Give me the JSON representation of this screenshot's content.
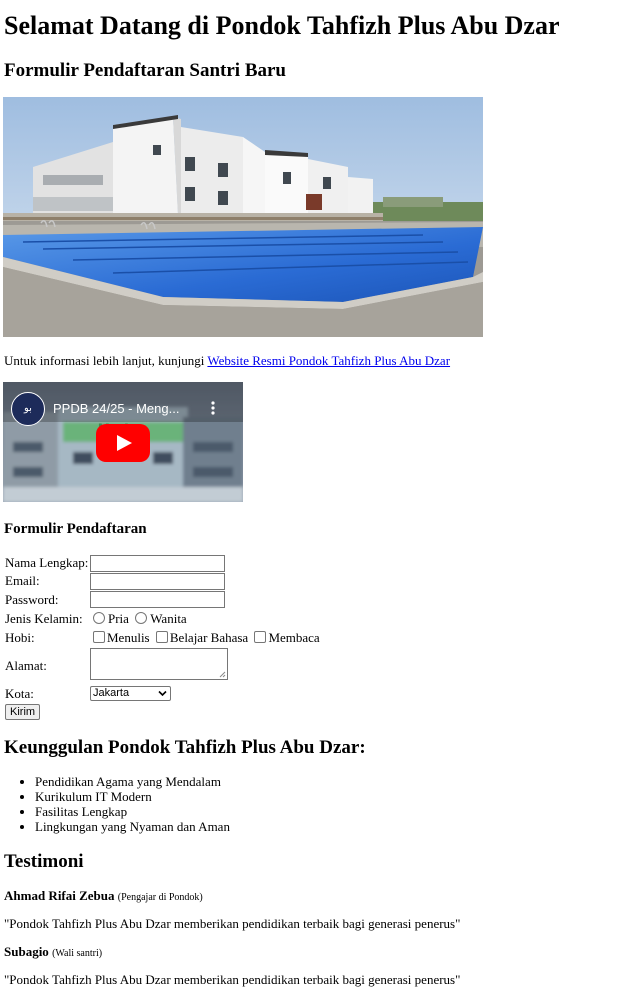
{
  "header": {
    "title": "Selamat Datang di Pondok Tahfizh Plus Abu Dzar",
    "subtitle": "Formulir Pendaftaran Santri Baru"
  },
  "info": {
    "text": "Untuk informasi lebih lanjut, kunjungi ",
    "link_text": "Website Resmi Pondok Tahfizh Plus Abu Dzar"
  },
  "video": {
    "title": "PPDB 24/25 - Meng...",
    "channel_badge": "بو",
    "banner": "M...A"
  },
  "form": {
    "title": "Formulir Pendaftaran",
    "labels": {
      "nama": "Nama Lengkap:",
      "email": "Email:",
      "password": "Password:",
      "jenis_kelamin": "Jenis Kelamin:",
      "hobi": "Hobi:",
      "alamat": "Alamat:",
      "kota": "Kota:"
    },
    "gender_options": [
      "Pria",
      "Wanita"
    ],
    "hobby_options": [
      "Menulis",
      "Belajar Bahasa",
      "Membaca"
    ],
    "kota_selected": "Jakarta",
    "submit_label": "Kirim"
  },
  "advantages": {
    "title": "Keunggulan Pondok Tahfizh Plus Abu Dzar:",
    "items": [
      "Pendidikan Agama yang Mendalam",
      "Kurikulum IT Modern",
      "Fasilitas Lengkap",
      "Lingkungan yang Nyaman dan Aman"
    ]
  },
  "testimonials": {
    "title": "Testimoni",
    "items": [
      {
        "name": "Ahmad Rifai Zebua",
        "role": "(Pengajar di Pondok)",
        "quote": "\"Pondok Tahfizh Plus Abu Dzar memberikan pendidikan terbaik bagi generasi penerus\""
      },
      {
        "name": "Subagio",
        "role": "(Wali santri)",
        "quote": "\"Pondok Tahfizh Plus Abu Dzar memberikan pendidikan terbaik bagi generasi penerus\""
      }
    ]
  },
  "colors": {
    "link": "#0000ee",
    "youtube_red": "#ff0000",
    "pool_blue": "#2f6fd6"
  },
  "icons": {
    "play": "play-icon",
    "more": "more-vert-icon",
    "dropdown": "chevron-down-icon"
  }
}
